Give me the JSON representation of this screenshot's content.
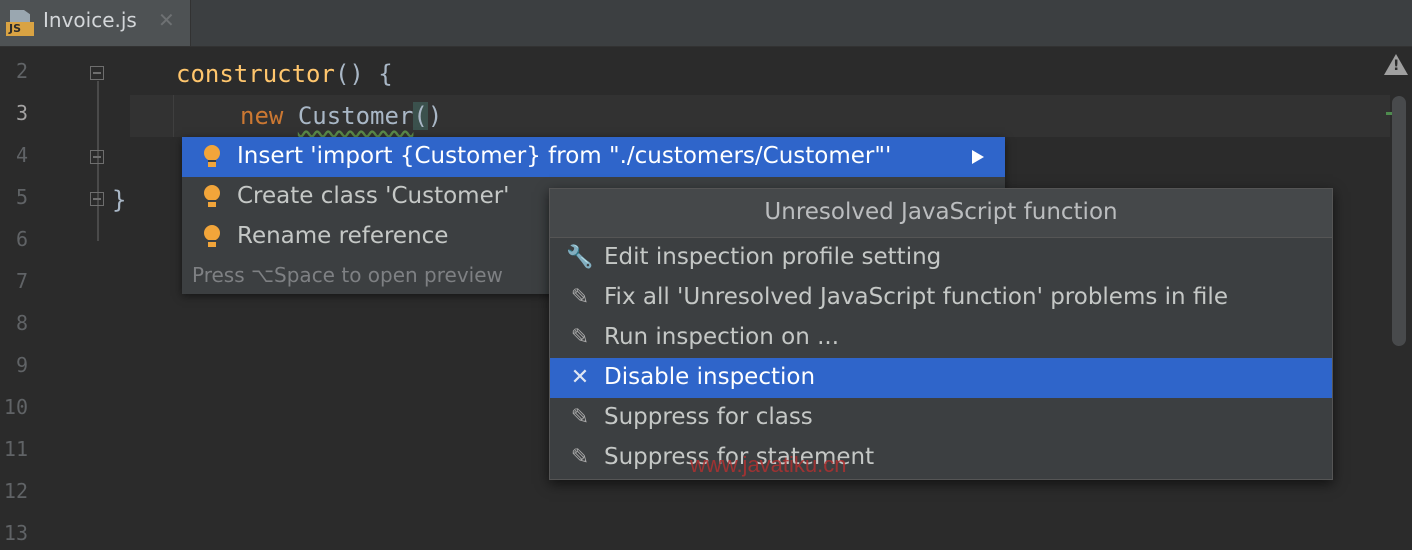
{
  "tab": {
    "title": "Invoice.js",
    "icon_badge": "JS",
    "close": "✕"
  },
  "gutter": {
    "lines": [
      "2",
      "3",
      "4",
      "5",
      "6",
      "7",
      "8",
      "9",
      "10",
      "11",
      "12",
      "13"
    ]
  },
  "code": {
    "line2": {
      "keyword": "constructor",
      "rest": "() {"
    },
    "line3": {
      "keyword": "new",
      "identifier": "Customer",
      "open_paren": "(",
      "close_paren": ")"
    },
    "line5": {
      "text": "}"
    }
  },
  "intention_popup": {
    "items": [
      {
        "label": "Insert 'import {Customer} from \"./customers/Customer\"'",
        "icon": "lightbulb-icon",
        "selected": true,
        "has_submenu": true
      },
      {
        "label": "Create class 'Customer'",
        "icon": "lightbulb-icon",
        "selected": false
      },
      {
        "label": "Rename reference",
        "icon": "lightbulb-icon",
        "selected": false
      }
    ],
    "footer": "Press ⌥Space to open preview"
  },
  "inspection_popup": {
    "title": "Unresolved JavaScript function",
    "items": [
      {
        "label": "Edit inspection profile setting",
        "icon": "wrench-icon",
        "glyph": "🔧"
      },
      {
        "label": "Fix all 'Unresolved JavaScript function' problems in file",
        "icon": "edit-icon",
        "glyph": "✎"
      },
      {
        "label": "Run inspection on ...",
        "icon": "edit-icon",
        "glyph": "✎"
      },
      {
        "label": "Disable inspection",
        "icon": "close-icon",
        "glyph": "✕",
        "selected": true
      },
      {
        "label": "Suppress for class",
        "icon": "edit-icon",
        "glyph": "✎"
      },
      {
        "label": "Suppress for statement",
        "icon": "edit-icon",
        "glyph": "✎"
      }
    ]
  },
  "watermark": "www.javatiku.cn",
  "colors": {
    "selection": "#2f65ca",
    "keyword": "#cc7832",
    "function": "#ffc66d",
    "bulb": "#f2a53a"
  }
}
